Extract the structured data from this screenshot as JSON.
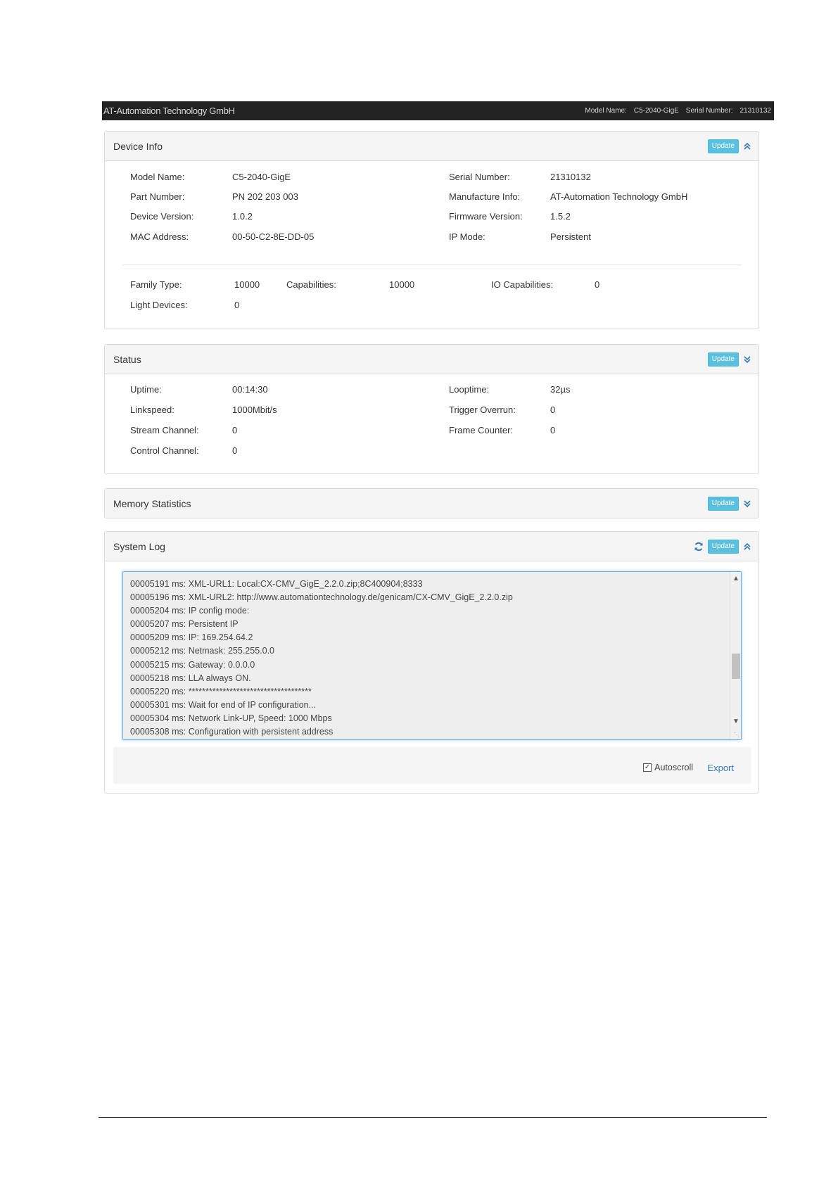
{
  "topbar": {
    "brand": "AT-Automation Technology GmbH",
    "model_name_label": "Model Name:",
    "model_name_value": "C5-2040-GigE",
    "serial_label": "Serial Number:",
    "serial_value": "21310132"
  },
  "device_info": {
    "title": "Device Info",
    "update_label": "Update",
    "collapse_icon": "chevron-double-up-icon",
    "left": [
      {
        "label": "Model Name:",
        "value": "C5-2040-GigE"
      },
      {
        "label": "Part Number:",
        "value": "PN 202 203 003"
      },
      {
        "label": "Device Version:",
        "value": "1.0.2"
      },
      {
        "label": "MAC Address:",
        "value": "00-50-C2-8E-DD-05"
      }
    ],
    "right": [
      {
        "label": "Serial Number:",
        "value": "21310132"
      },
      {
        "label": "Manufacture Info:",
        "value": "AT-Automation Technology GmbH"
      },
      {
        "label": "Firmware Version:",
        "value": "1.5.2"
      },
      {
        "label": "IP Mode:",
        "value": "Persistent"
      }
    ],
    "family_type_label": "Family Type:",
    "family_type_value": "10000",
    "capabilities_label": "Capabilities:",
    "capabilities_value": "10000",
    "io_capabilities_label": "IO Capabilities:",
    "io_capabilities_value": "0",
    "light_devices_label": "Light Devices:",
    "light_devices_value": "0"
  },
  "status": {
    "title": "Status",
    "update_label": "Update",
    "expand_icon": "chevron-double-down-icon",
    "left": [
      {
        "label": "Uptime:",
        "value": "00:14:30"
      },
      {
        "label": "Linkspeed:",
        "value": "1000Mbit/s"
      },
      {
        "label": "Stream Channel:",
        "value": "0"
      },
      {
        "label": "Control Channel:",
        "value": "0"
      }
    ],
    "right": [
      {
        "label": "Looptime:",
        "value": "32µs"
      },
      {
        "label": "Trigger Overrun:",
        "value": "0"
      },
      {
        "label": "Frame Counter:",
        "value": "0"
      }
    ]
  },
  "memory_statistics": {
    "title": "Memory Statistics",
    "update_label": "Update",
    "expand_icon": "chevron-double-down-icon"
  },
  "system_log": {
    "title": "System Log",
    "update_label": "Update",
    "refresh_icon": "refresh-icon",
    "collapse_icon": "chevron-double-up-icon",
    "lines": [
      "00005191 ms: XML-URL1: Local:CX-CMV_GigE_2.2.0.zip;8C400904;8333",
      "00005196 ms: XML-URL2: http://www.automationtechnology.de/genicam/CX-CMV_GigE_2.2.0.zip",
      "00005204 ms: IP config mode:",
      "00005207 ms: Persistent IP",
      "00005209 ms: IP: 169.254.64.2",
      "00005212 ms: Netmask: 255.255.0.0",
      "00005215 ms: Gateway: 0.0.0.0",
      "00005218 ms: LLA always ON.",
      "00005220 ms: ************************************",
      "00005301 ms: Wait for end of IP configuration...",
      "00005304 ms: Network Link-UP, Speed: 1000 Mbps",
      "00005308 ms: Configuration with persistent address"
    ],
    "autoscroll_label": "Autoscroll",
    "autoscroll_checked": true,
    "export_label": "Export"
  },
  "colors": {
    "topbar_bg": "#222222",
    "update_button": "#5bc0de",
    "link": "#337ab7"
  }
}
